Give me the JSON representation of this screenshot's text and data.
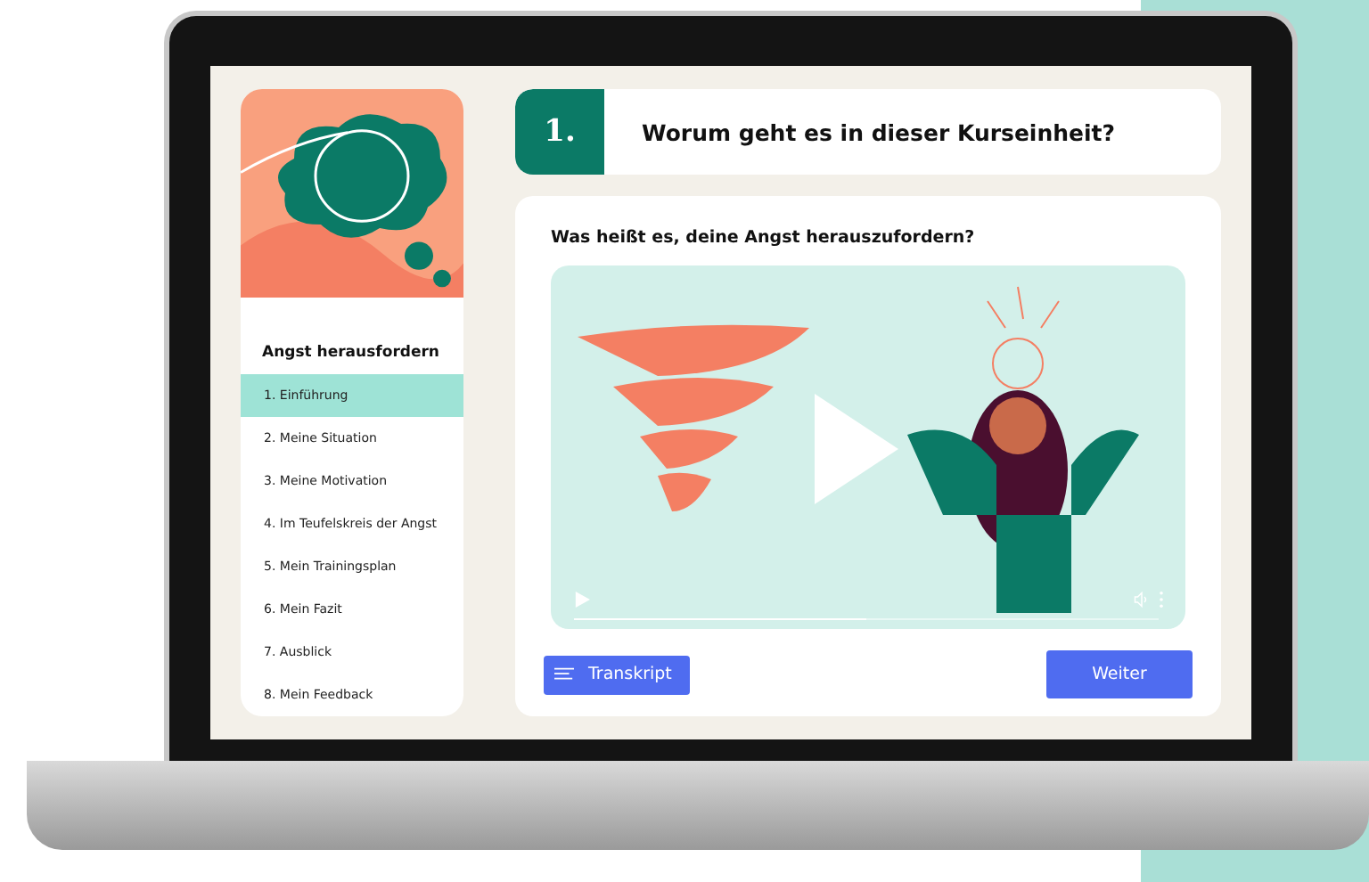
{
  "sidebar": {
    "title": "Angst herausfordern",
    "items": [
      {
        "number": "1.",
        "label": "Einführung",
        "selected": true
      },
      {
        "number": "2.",
        "label": "Meine Situation",
        "selected": false
      },
      {
        "number": "3.",
        "label": "Meine Motivation",
        "selected": false
      },
      {
        "number": "4.",
        "label": "Im Teufelskreis der Angst",
        "selected": false
      },
      {
        "number": "5.",
        "label": "Mein Trainingsplan",
        "selected": false
      },
      {
        "number": "6.",
        "label": "Mein Fazit",
        "selected": false
      },
      {
        "number": "7.",
        "label": "Ausblick",
        "selected": false
      },
      {
        "number": "8.",
        "label": "Mein Feedback",
        "selected": false
      }
    ]
  },
  "header": {
    "number": "1.",
    "title": "Worum geht es in dieser Kurseinheit?"
  },
  "content": {
    "question": "Was heißt es, deine Angst herauszufordern?",
    "video": {
      "level": 0.5
    }
  },
  "buttons": {
    "transcript": "Transkript",
    "next": "Weiter"
  }
}
